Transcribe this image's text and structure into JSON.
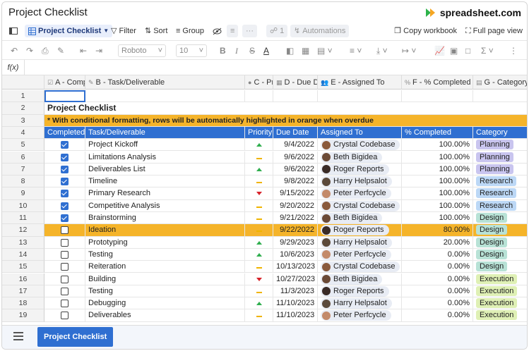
{
  "window": {
    "title": "Project Checklist",
    "brand": "spreadsheet.com"
  },
  "viewbar": {
    "view_name": "Project Checklist",
    "filter": "Filter",
    "sort": "Sort",
    "group": "Group",
    "row_count": "1",
    "automations": "Automations",
    "copy_workbook": "Copy workbook",
    "full_page": "Full page view"
  },
  "format": {
    "font": "Roboto",
    "size": "10"
  },
  "formula": {
    "fx": "f(x)"
  },
  "columns": [
    {
      "label": "A - Comp"
    },
    {
      "label": "B - Task/Deliverable"
    },
    {
      "label": "C - Pr"
    },
    {
      "label": "D - Due Da"
    },
    {
      "label": "E - Assigned To"
    },
    {
      "label": "F - % Completed"
    },
    {
      "label": "G - Category"
    }
  ],
  "sheet": {
    "title": "Project Checklist",
    "notice": "* With conditional formatting, rows will be automatically highlighted in orange when overdue",
    "headers": [
      "Completed",
      "Task/Deliverable",
      "Priority",
      "Due Date",
      "Assigned To",
      "% Completed",
      "Category"
    ]
  },
  "rows": [
    {
      "n": "5",
      "done": true,
      "task": "Project Kickoff",
      "pri": "up",
      "due": "9/4/2022",
      "who": "Crystal Codebase",
      "pct": "100.00%",
      "cat": "Planning",
      "overdue": false
    },
    {
      "n": "6",
      "done": true,
      "task": "Limitations Analysis",
      "pri": "mid",
      "due": "9/6/2022",
      "who": "Beth Bigidea",
      "pct": "100.00%",
      "cat": "Planning",
      "overdue": false
    },
    {
      "n": "7",
      "done": true,
      "task": "Deliverables List",
      "pri": "up",
      "due": "9/6/2022",
      "who": "Roger Reports",
      "pct": "100.00%",
      "cat": "Planning",
      "overdue": false
    },
    {
      "n": "8",
      "done": true,
      "task": "Timeline",
      "pri": "mid",
      "due": "9/8/2022",
      "who": "Harry Helpsalot",
      "pct": "100.00%",
      "cat": "Research",
      "overdue": false
    },
    {
      "n": "9",
      "done": true,
      "task": "Primary Research",
      "pri": "down",
      "due": "9/15/2022",
      "who": "Peter Perfcycle",
      "pct": "100.00%",
      "cat": "Research",
      "overdue": false
    },
    {
      "n": "10",
      "done": true,
      "task": "Competitive Analysis",
      "pri": "mid",
      "due": "9/20/2022",
      "who": "Crystal Codebase",
      "pct": "100.00%",
      "cat": "Research",
      "overdue": false
    },
    {
      "n": "11",
      "done": true,
      "task": "Brainstorming",
      "pri": "mid",
      "due": "9/21/2022",
      "who": "Beth Bigidea",
      "pct": "100.00%",
      "cat": "Design",
      "overdue": false
    },
    {
      "n": "12",
      "done": false,
      "task": "Ideation",
      "pri": "mid",
      "due": "9/22/2022",
      "who": "Roger Reports",
      "pct": "80.00%",
      "cat": "Design",
      "overdue": true
    },
    {
      "n": "13",
      "done": false,
      "task": "Prototyping",
      "pri": "up",
      "due": "9/29/2023",
      "who": "Harry Helpsalot",
      "pct": "20.00%",
      "cat": "Design",
      "overdue": false
    },
    {
      "n": "14",
      "done": false,
      "task": "Testing",
      "pri": "up",
      "due": "10/6/2023",
      "who": "Peter Perfcycle",
      "pct": "0.00%",
      "cat": "Design",
      "overdue": false
    },
    {
      "n": "15",
      "done": false,
      "task": "Reiteration",
      "pri": "mid",
      "due": "10/13/2023",
      "who": "Crystal Codebase",
      "pct": "0.00%",
      "cat": "Design",
      "overdue": false
    },
    {
      "n": "16",
      "done": false,
      "task": "Building",
      "pri": "down",
      "due": "10/27/2023",
      "who": "Beth Bigidea",
      "pct": "0.00%",
      "cat": "Execution",
      "overdue": false
    },
    {
      "n": "17",
      "done": false,
      "task": "Testing",
      "pri": "mid",
      "due": "11/3/2023",
      "who": "Roger Reports",
      "pct": "0.00%",
      "cat": "Execution",
      "overdue": false
    },
    {
      "n": "18",
      "done": false,
      "task": "Debugging",
      "pri": "up",
      "due": "11/10/2023",
      "who": "Harry Helpsalot",
      "pct": "0.00%",
      "cat": "Execution",
      "overdue": false
    },
    {
      "n": "19",
      "done": false,
      "task": "Deliverables",
      "pri": "mid",
      "due": "11/10/2023",
      "who": "Peter Perfcycle",
      "pct": "0.00%",
      "cat": "Execution",
      "overdue": false
    }
  ],
  "colors": {
    "accent": "#2f6fd1",
    "overdue": "#f5b42a",
    "notice": "#f5b42a",
    "cat_planning": "#c9c5ef",
    "cat_research": "#bcd8f6",
    "cat_design": "#b8e2d6",
    "cat_execution": "#dff0b5"
  },
  "tabs": [
    {
      "label": "Project Checklist"
    }
  ]
}
